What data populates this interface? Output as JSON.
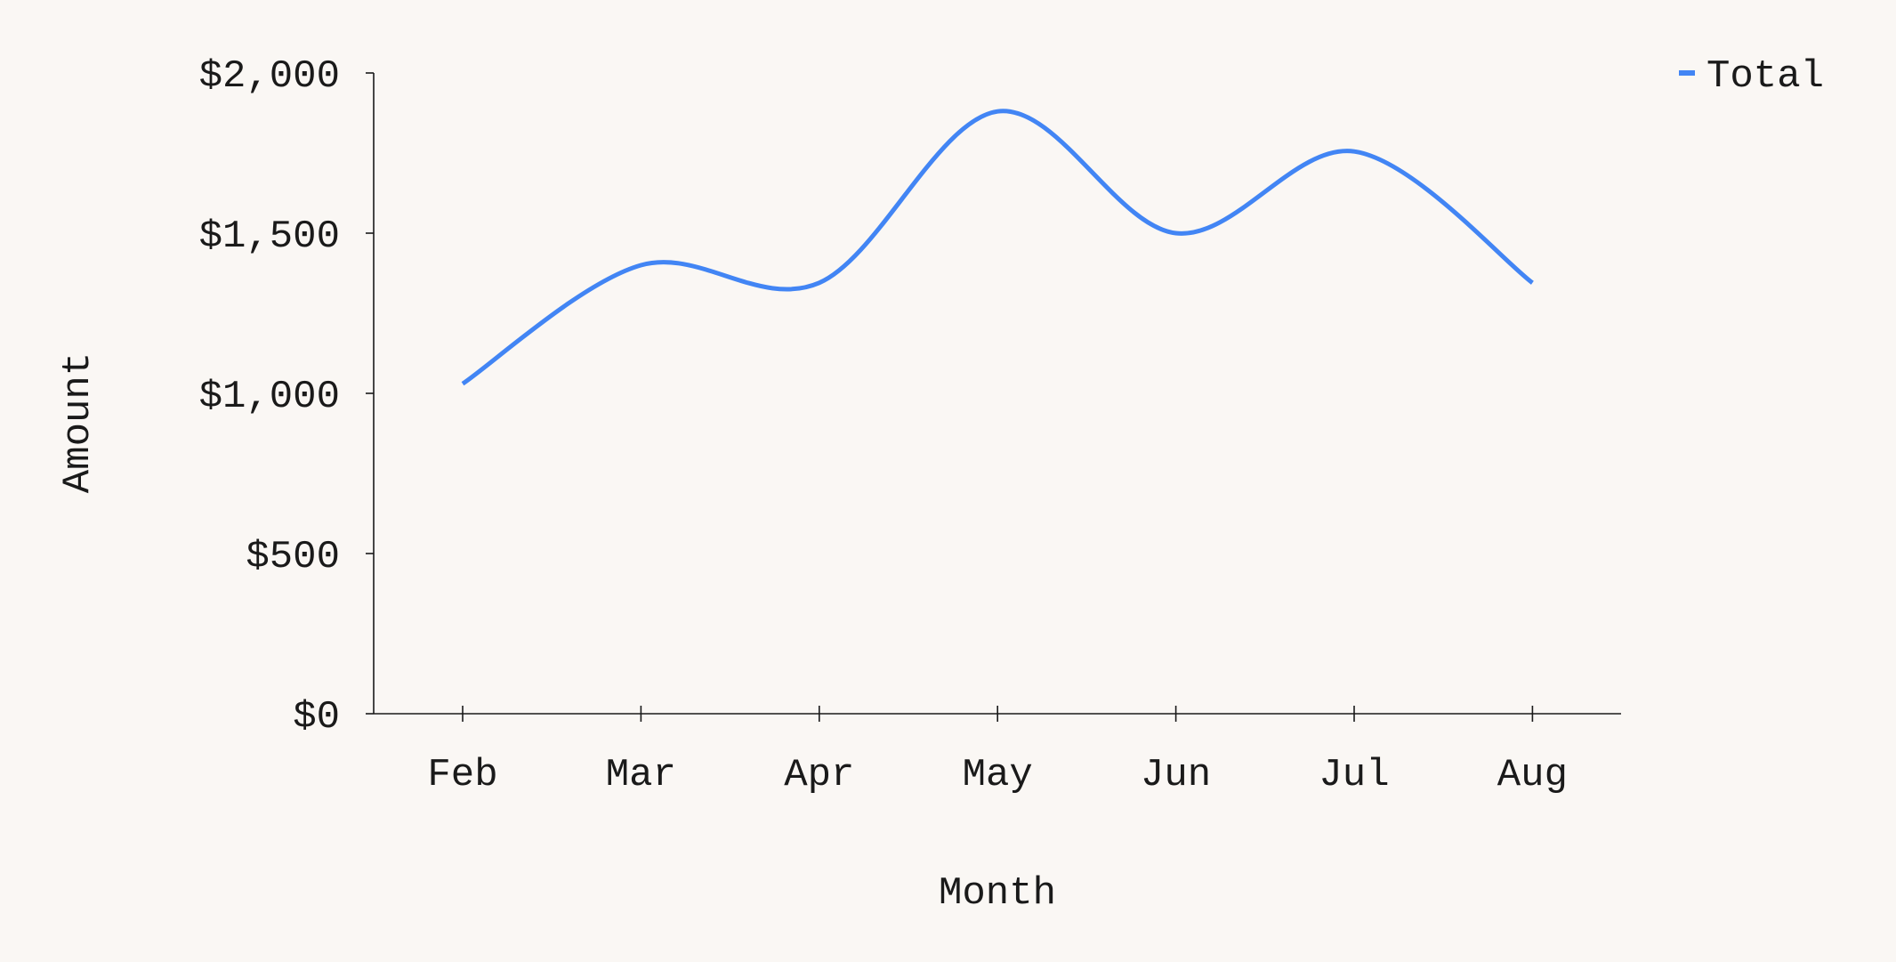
{
  "chart_data": {
    "type": "line",
    "title": "",
    "xlabel": "Month",
    "ylabel": "Amount",
    "categories": [
      "Feb",
      "Mar",
      "Apr",
      "May",
      "Jun",
      "Jul",
      "Aug"
    ],
    "series": [
      {
        "name": "Total",
        "color": "#4285f4",
        "values": [
          1030,
          1400,
          1345,
          1880,
          1500,
          1755,
          1345
        ]
      }
    ],
    "ylim": [
      0,
      2000
    ],
    "yticks": [
      0,
      500,
      1000,
      1500,
      2000
    ],
    "ytick_labels": [
      "$0",
      "$500",
      "$1,000",
      "$1,500",
      "$2,000"
    ],
    "grid": false,
    "curve": "smooth",
    "legend": {
      "position": "top-right",
      "entries": [
        "Total"
      ]
    }
  }
}
